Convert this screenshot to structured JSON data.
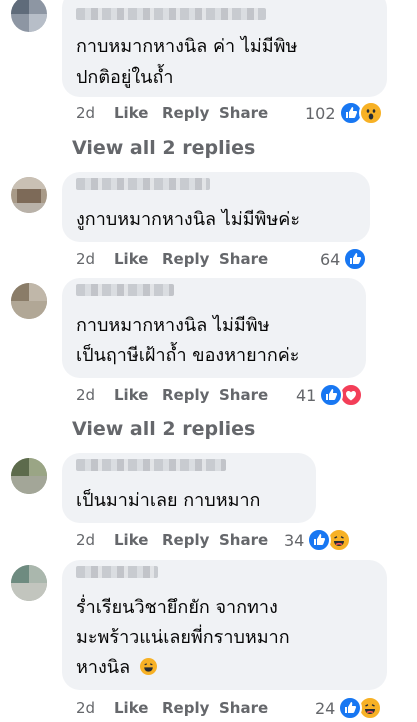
{
  "colors": {
    "bubble": "#f0f2f5",
    "meta_text": "#65676b",
    "like_blue": "#1877f2",
    "love_red": "#f33e58",
    "emoji_yellow": "#f7b125"
  },
  "comments": [
    {
      "lines": [
        "กาบหมากหางนิล ค่า ไม่มีพิษ",
        "ปกติอยู่ในถ้ำ"
      ],
      "time": "2d",
      "like": "Like",
      "reply": "Reply",
      "share": "Share",
      "reaction_count": "102",
      "reactions": [
        "like-icon",
        "wow-icon"
      ]
    },
    {
      "lines": [
        "งูกาบหมากหางนิล ไม่มีพิษค่ะ"
      ],
      "time": "2d",
      "like": "Like",
      "reply": "Reply",
      "share": "Share",
      "reaction_count": "64",
      "reactions": [
        "like-icon"
      ]
    },
    {
      "lines": [
        "กาบหมากหางนิล ไม่มีพิษ",
        "เป็นฤาษีเฝ้าถ้ำ ของหายากค่ะ"
      ],
      "time": "2d",
      "like": "Like",
      "reply": "Reply",
      "share": "Share",
      "reaction_count": "41",
      "reactions": [
        "like-icon",
        "love-icon"
      ]
    },
    {
      "lines": [
        "เป็นมาม่าเลย กาบหมาก"
      ],
      "time": "2d",
      "like": "Like",
      "reply": "Reply",
      "share": "Share",
      "reaction_count": "34",
      "reactions": [
        "like-icon",
        "haha-icon"
      ]
    },
    {
      "lines": [
        "ร่ำเรียนวิชายึกยัก จากทาง",
        "มะพร้าวแน่เลยพี่กราบหมาก",
        "หางนิล"
      ],
      "inline_emoji": "laughing-emoji-icon",
      "time": "2d",
      "like": "Like",
      "reply": "Reply",
      "share": "Share",
      "reaction_count": "24",
      "reactions": [
        "like-icon",
        "haha-icon"
      ]
    }
  ],
  "view_replies": [
    "View all 2 replies",
    "View all 2 replies"
  ]
}
